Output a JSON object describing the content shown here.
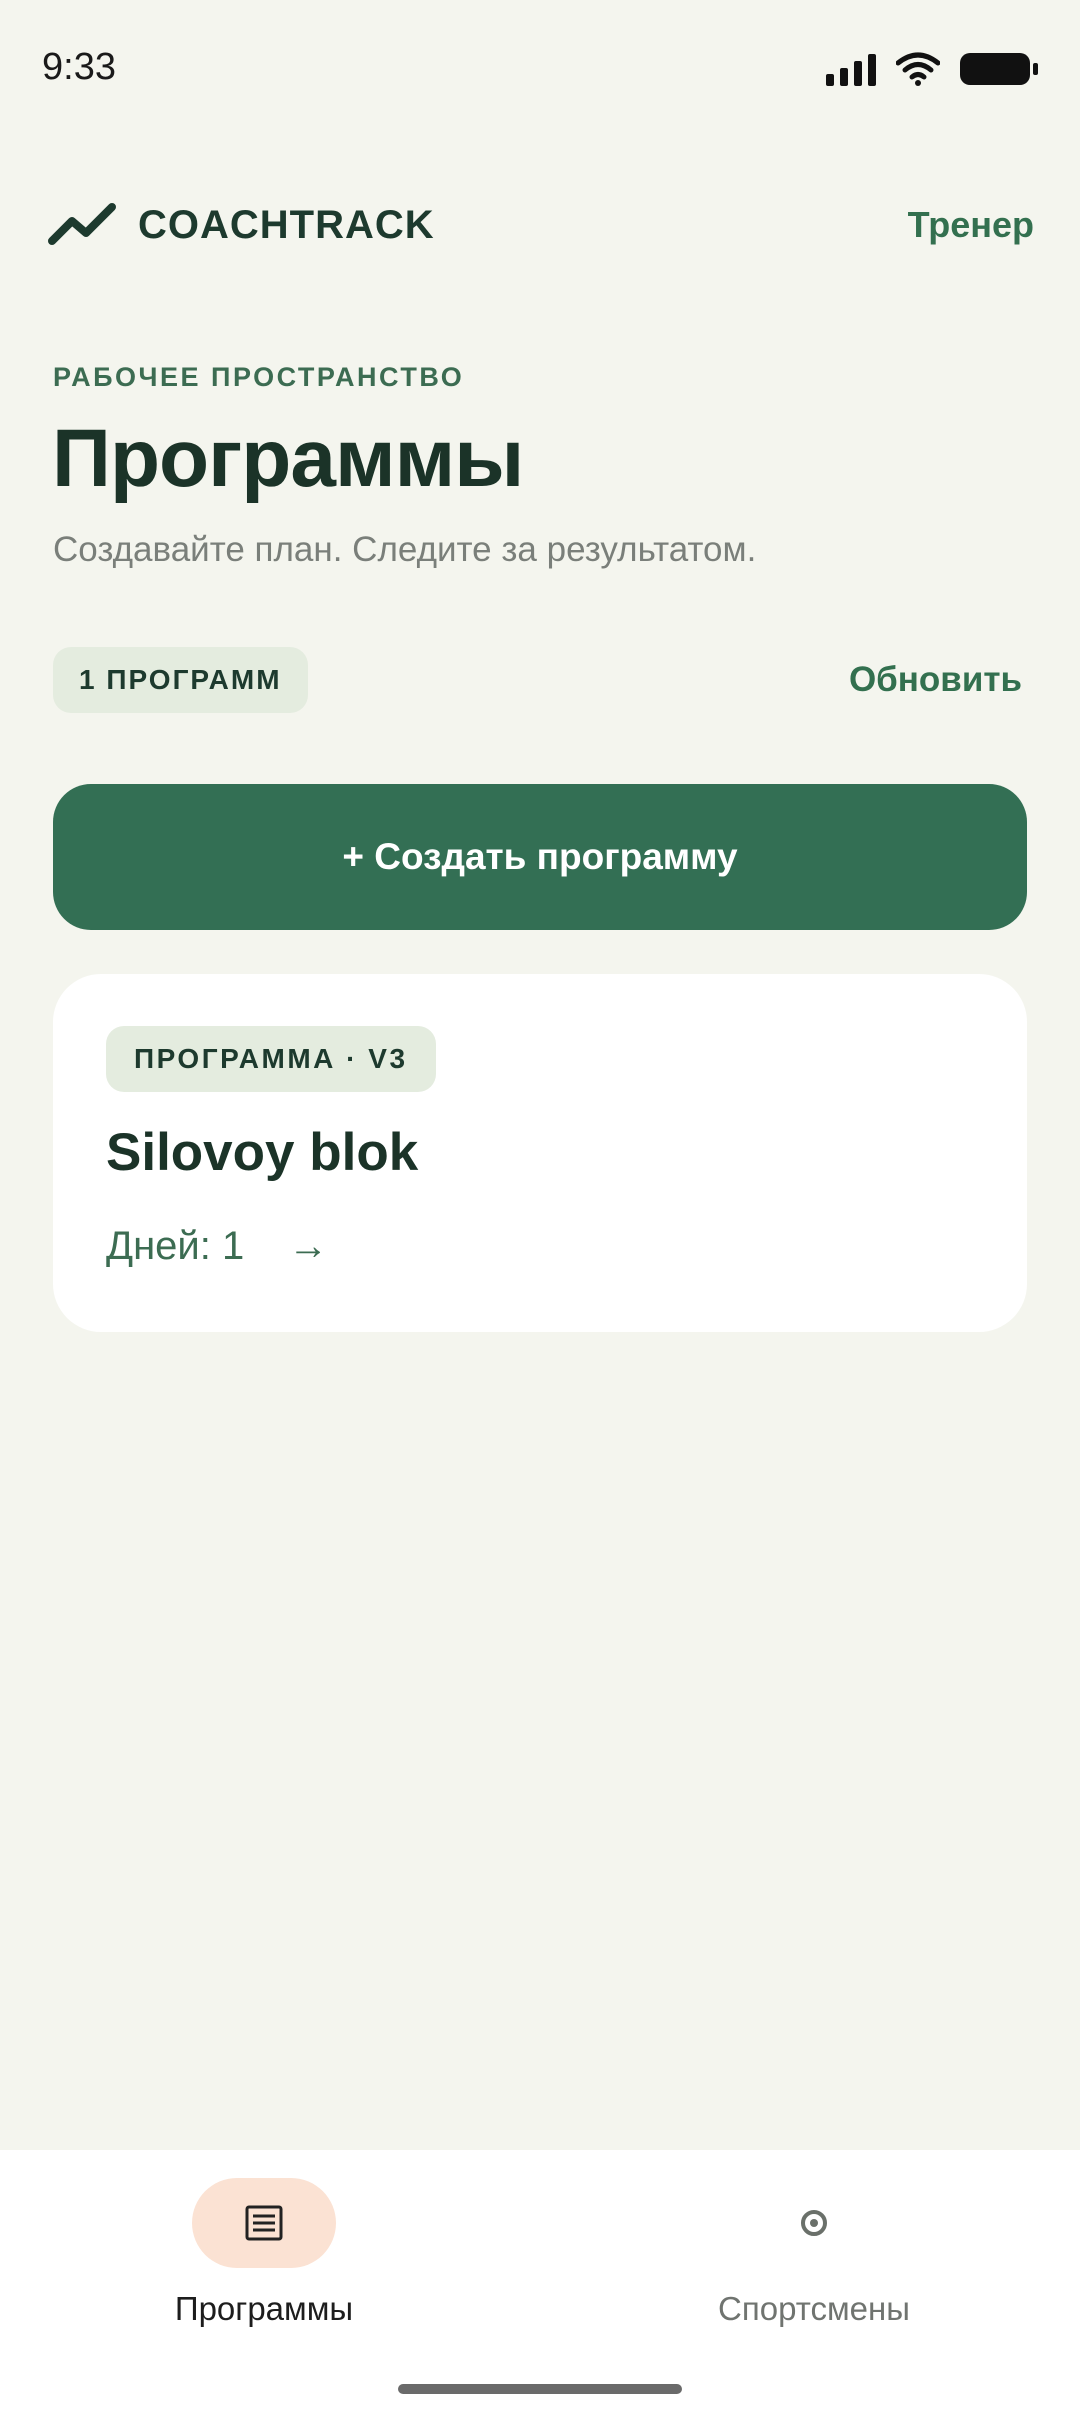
{
  "status_bar": {
    "time": "9:33"
  },
  "header": {
    "brand_name": "COACHTRACK",
    "role_link": "Тренер"
  },
  "page": {
    "eyebrow": "РАБОЧЕЕ ПРОСТРАНСТВО",
    "title": "Программы",
    "subtitle": "Создавайте план. Следите за результатом.",
    "count_badge": "1 ПРОГРАММ",
    "refresh_label": "Обновить",
    "create_button": "+ Создать программу"
  },
  "programs": [
    {
      "tag": "ПРОГРАММА · V3",
      "title": "Silovoy blok",
      "days": "Дней: 1",
      "arrow": "→"
    }
  ],
  "bottom_nav": {
    "items": [
      {
        "label": "Программы",
        "icon": "list-icon",
        "active": true
      },
      {
        "label": "Спортсмены",
        "icon": "target-icon",
        "active": false
      }
    ]
  },
  "colors": {
    "background": "#f4f5ee",
    "primary": "#336f54",
    "badge_bg": "#e4ecdf",
    "active_nav_pill": "#fbe2d3",
    "title_text": "#1b3328"
  }
}
